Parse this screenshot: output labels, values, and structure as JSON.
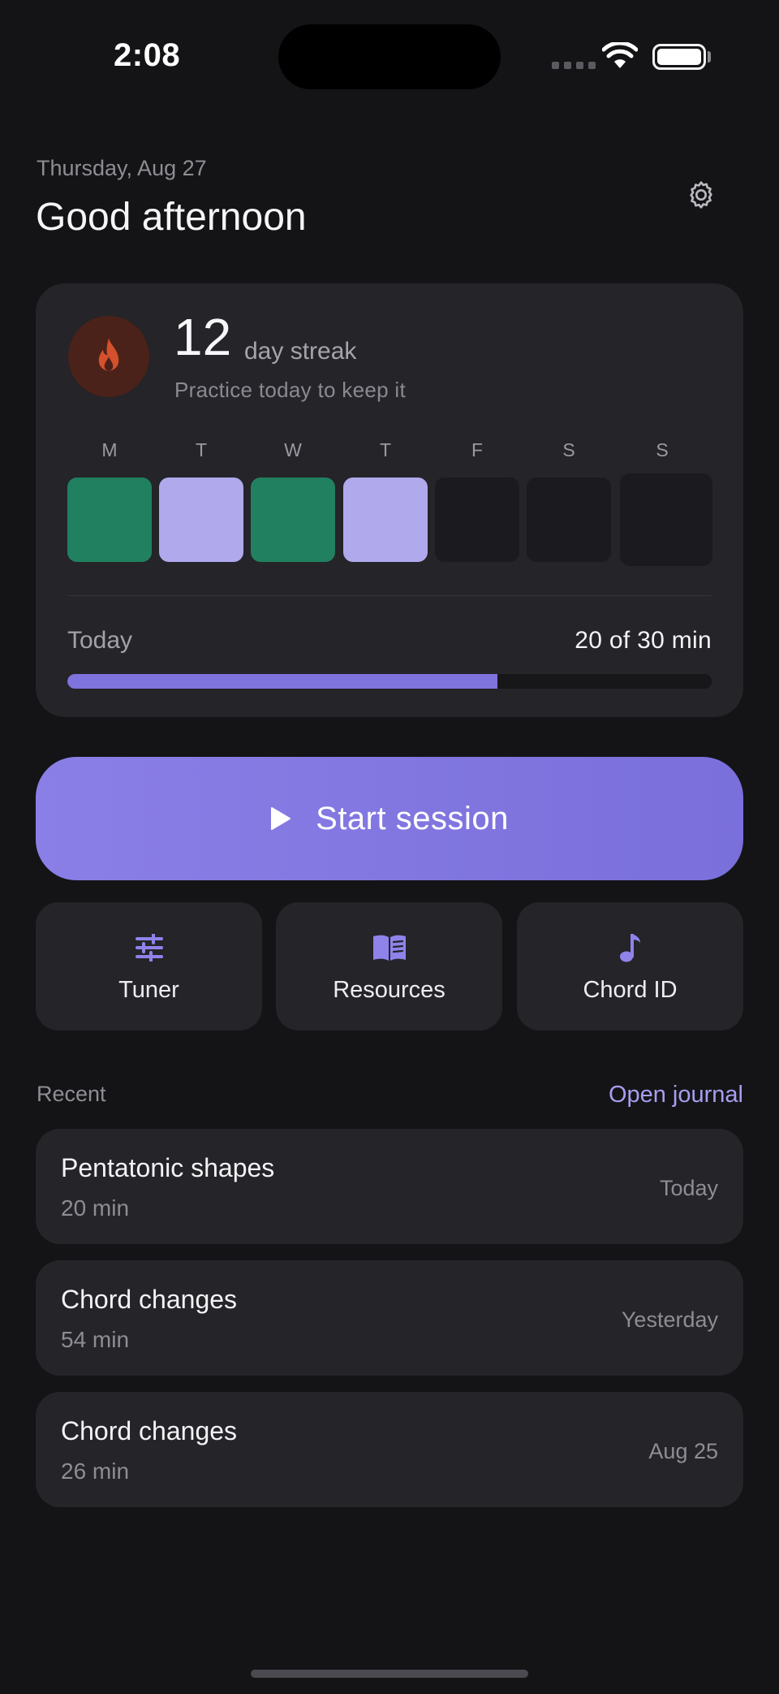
{
  "status_bar": {
    "time": "2:08"
  },
  "header": {
    "date": "Thursday, Aug 27",
    "greeting": "Good afternoon",
    "settings_icon": "gear-icon"
  },
  "streak": {
    "count": "12",
    "unit": "day streak",
    "hint": "Practice today to keep it",
    "icon": "flame-icon",
    "days": [
      {
        "letter": "M",
        "status": "completed",
        "color": "#21805f"
      },
      {
        "letter": "T",
        "status": "partial",
        "color": "#b0a9ec"
      },
      {
        "letter": "W",
        "status": "completed",
        "color": "#21805f"
      },
      {
        "letter": "T",
        "status": "partial",
        "color": "#b0a9ec"
      },
      {
        "letter": "F",
        "status": "empty",
        "color": "#1b1b1f"
      },
      {
        "letter": "S",
        "status": "empty",
        "color": "#1b1b1f"
      },
      {
        "letter": "S",
        "status": "empty",
        "color": "#1b1b1f"
      }
    ]
  },
  "today": {
    "label": "Today",
    "value": "20 of 30 min",
    "progress_fraction": 0.667,
    "accent": "#7f73dd"
  },
  "start_session": {
    "label": "Start session",
    "icon": "play-icon"
  },
  "tools": [
    {
      "label": "Tuner",
      "icon": "sliders-icon"
    },
    {
      "label": "Resources",
      "icon": "book-icon"
    },
    {
      "label": "Chord ID",
      "icon": "music-note-icon"
    }
  ],
  "recent": {
    "title": "Recent",
    "link": "Open journal",
    "items": [
      {
        "title": "Pentatonic shapes",
        "duration": "20 min",
        "date": "Today"
      },
      {
        "title": "Chord changes",
        "duration": "54 min",
        "date": "Yesterday"
      },
      {
        "title": "Chord changes",
        "duration": "26 min",
        "date": "Aug 25"
      }
    ]
  }
}
